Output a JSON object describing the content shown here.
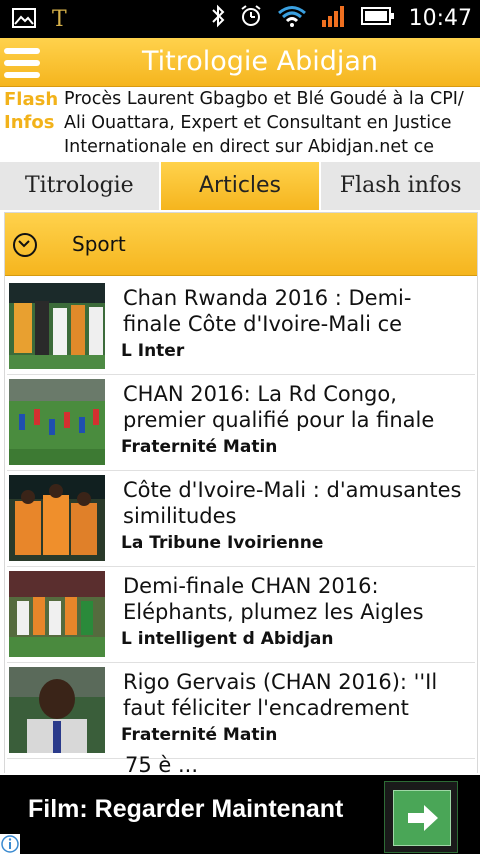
{
  "status_bar": {
    "time": "10:47"
  },
  "app": {
    "title": "Titrologie Abidjan"
  },
  "flash": {
    "label_line1": "Flash",
    "label_line2": "Infos",
    "text": "Procès Laurent Gbagbo et Blé Goudé à la CPI/ Ali Ouattara, Expert et Consultant en Justice Internationale en direct sur Abidjan.net ce jeudi à"
  },
  "tabs": [
    {
      "label": "Titrologie"
    },
    {
      "label": "Articles"
    },
    {
      "label": "Flash infos"
    }
  ],
  "section": {
    "title": "Sport"
  },
  "articles": [
    {
      "headline": "Chan Rwanda 2016 : Demi-finale Côte d'Ivoire-Mali ce",
      "source": "L Inter"
    },
    {
      "headline": "CHAN 2016: La Rd Congo, premier qualifié pour la finale",
      "source": "Fraternité Matin"
    },
    {
      "headline": "Côte d'Ivoire-Mali : d'amusantes similitudes",
      "source": "La Tribune Ivoirienne"
    },
    {
      "headline": "Demi-finale CHAN 2016: Eléphants, plumez les Aigles",
      "source": "L intelligent d Abidjan"
    },
    {
      "headline": "Rigo Gervais (CHAN 2016): ''Il faut féliciter l'encadrement",
      "source": "Fraternité Matin"
    }
  ],
  "partial_article": {
    "headline": "75 è ... "
  },
  "ad": {
    "text": "Film: Regarder Maintenant"
  },
  "colors": {
    "accent": "#f5b51e",
    "accent_light": "#ffd24c"
  }
}
